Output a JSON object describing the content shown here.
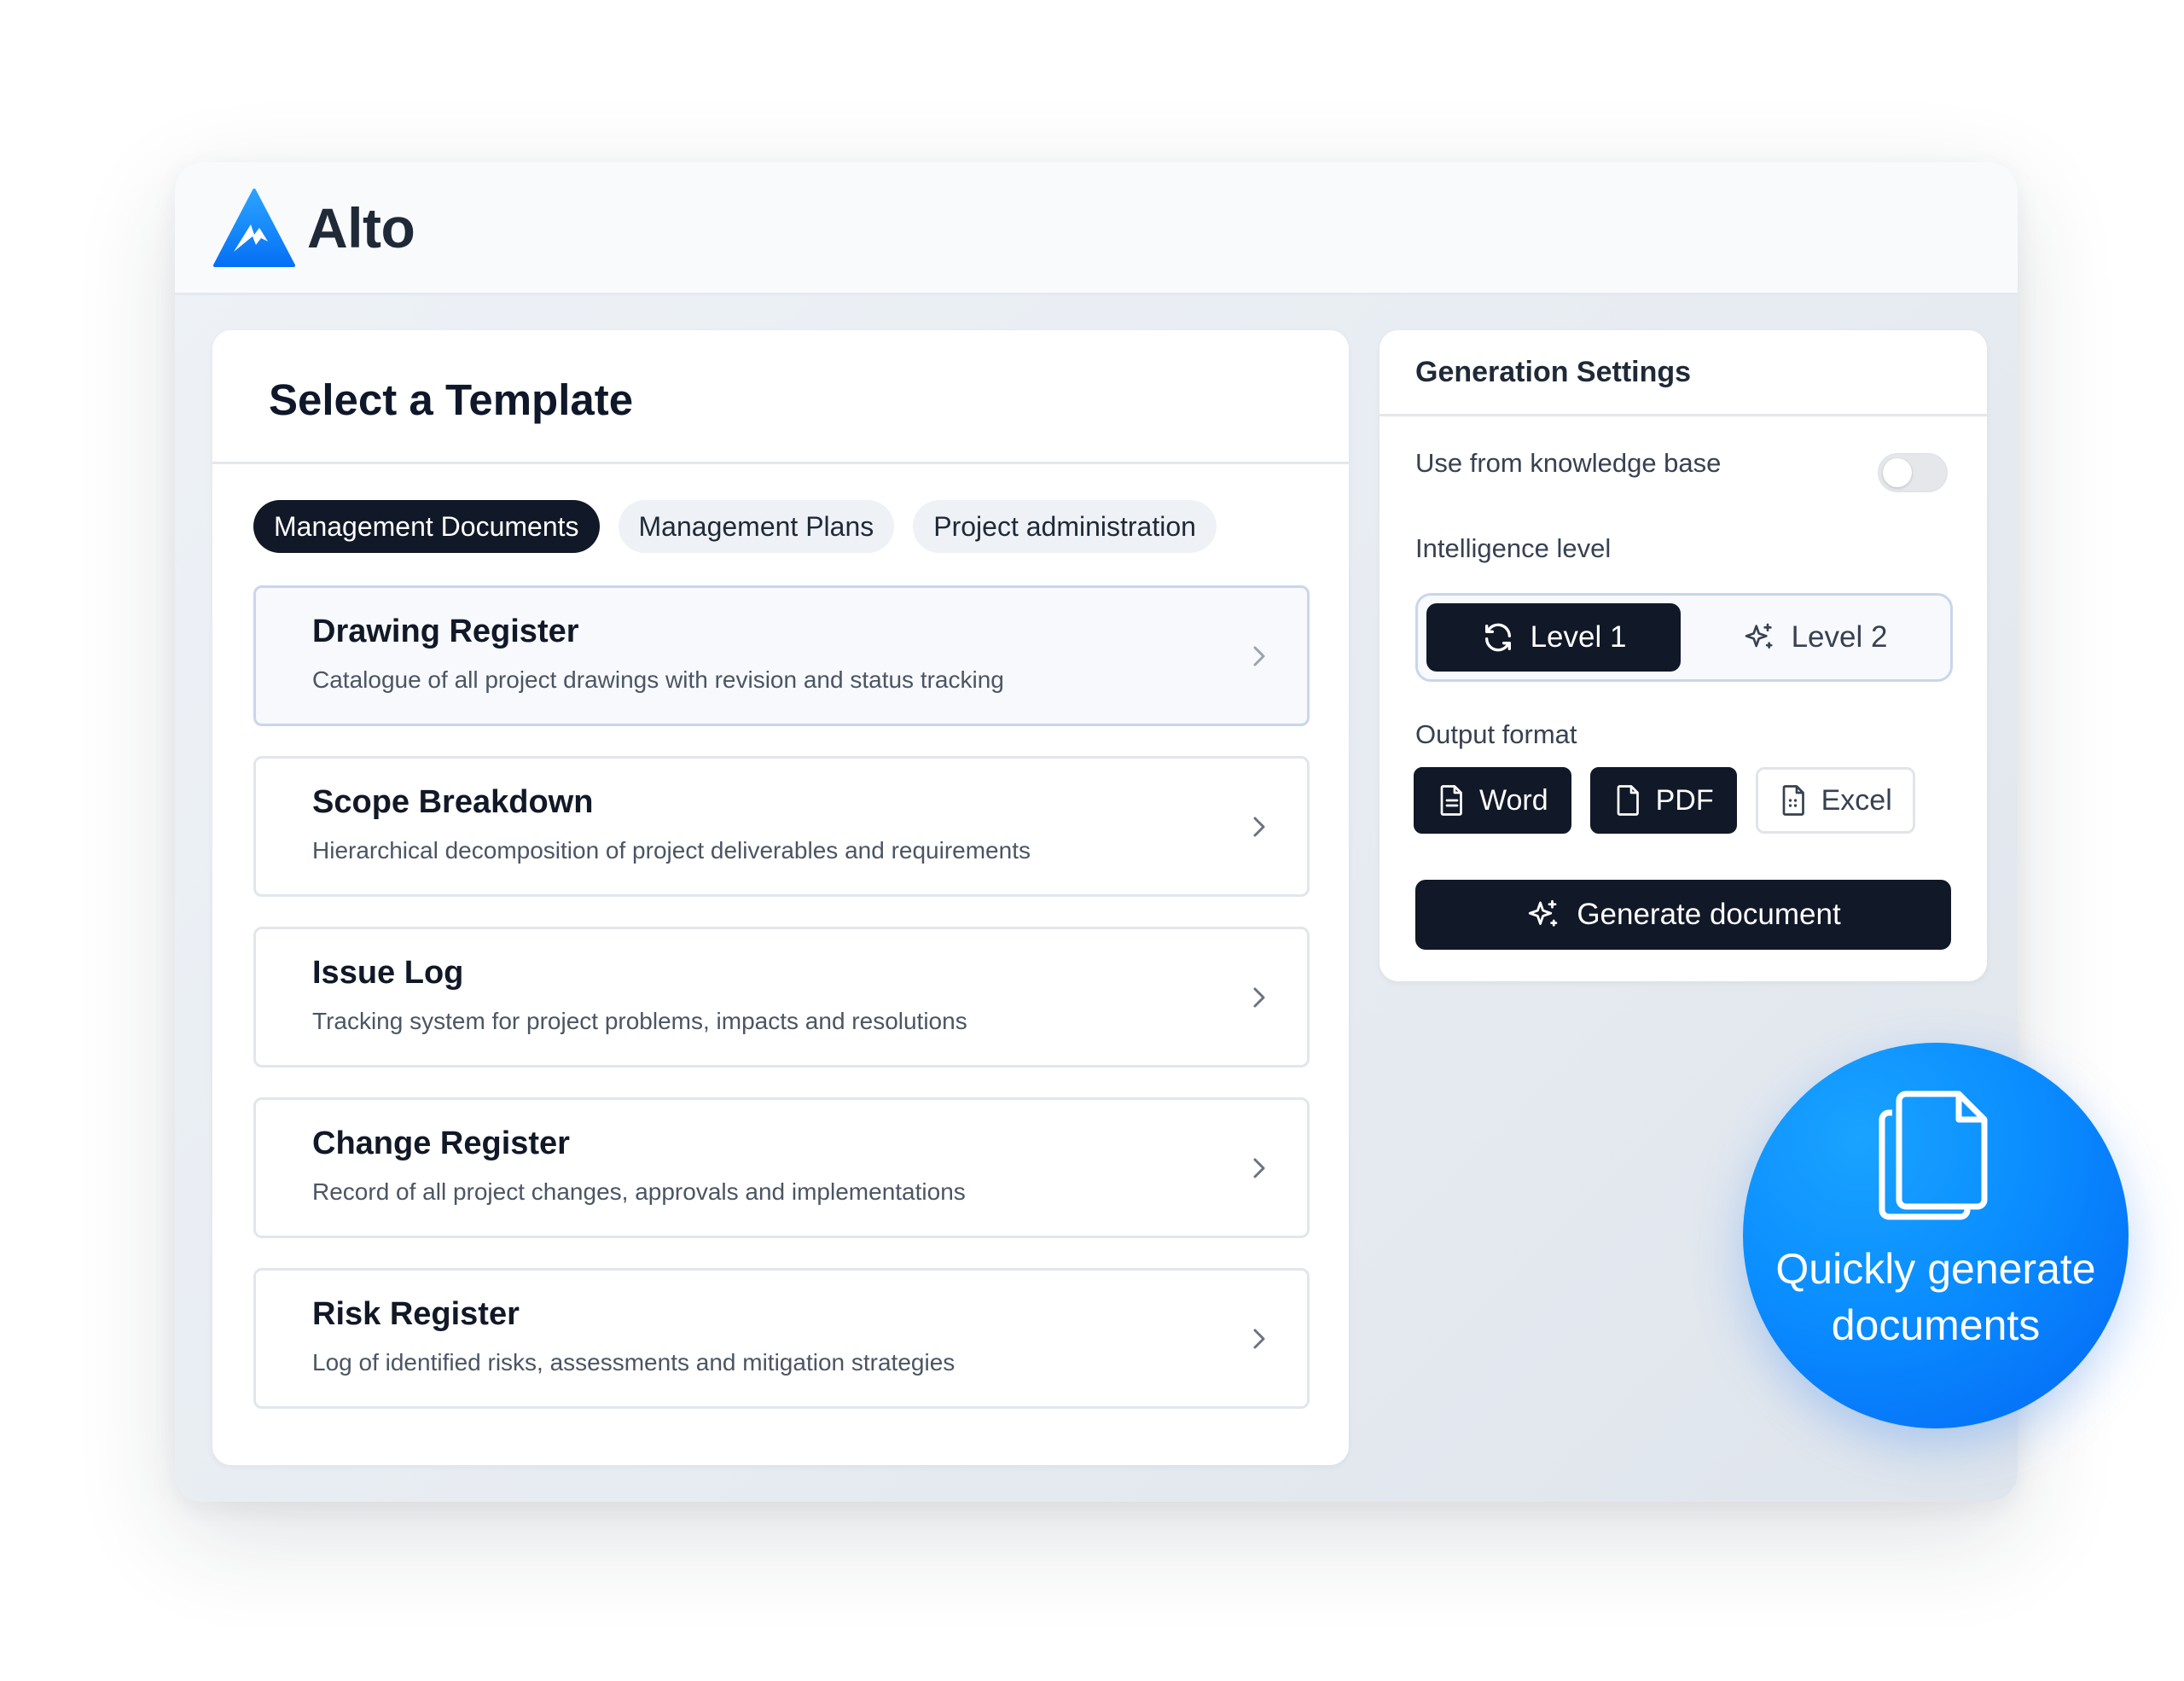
{
  "brand": {
    "name": "Alto",
    "logo_icon": "mountain-triangle-logo",
    "logo_color": "#0a8dff"
  },
  "templates": {
    "title": "Select a Template",
    "tabs": [
      {
        "label": "Management Documents",
        "active": true
      },
      {
        "label": "Management Plans",
        "active": false
      },
      {
        "label": "Project administration",
        "active": false
      }
    ],
    "items": [
      {
        "title": "Drawing Register",
        "description": "Catalogue of all project drawings with revision and status tracking",
        "selected": true
      },
      {
        "title": "Scope Breakdown",
        "description": "Hierarchical decomposition of project deliverables and requirements",
        "selected": false
      },
      {
        "title": "Issue Log",
        "description": "Tracking system for project problems, impacts and resolutions",
        "selected": false
      },
      {
        "title": "Change Register",
        "description": "Record of all project changes, approvals and implementations",
        "selected": false
      },
      {
        "title": "Risk Register",
        "description": "Log of identified risks, assessments and mitigation strategies",
        "selected": false
      }
    ]
  },
  "settings": {
    "title": "Generation Settings",
    "knowledge_base": {
      "label": "Use from knowledge base",
      "enabled": false
    },
    "intelligence": {
      "label": "Intelligence level",
      "options": [
        {
          "label": "Level 1",
          "icon": "refresh-icon",
          "selected": true
        },
        {
          "label": "Level 2",
          "icon": "sparkles-icon",
          "selected": false
        }
      ]
    },
    "output": {
      "label": "Output format",
      "options": [
        {
          "label": "Word",
          "icon": "document-text-icon",
          "selected": true
        },
        {
          "label": "PDF",
          "icon": "document-icon",
          "selected": true
        },
        {
          "label": "Excel",
          "icon": "spreadsheet-icon",
          "selected": false
        }
      ]
    },
    "generate_label": "Generate document"
  },
  "promo": {
    "line1": "Quickly generate",
    "line2": "documents",
    "icon": "copy-documents-icon"
  },
  "colors": {
    "dark": "#111827",
    "accent": "#0a8dff",
    "panel_bg": "#eef2f7"
  }
}
